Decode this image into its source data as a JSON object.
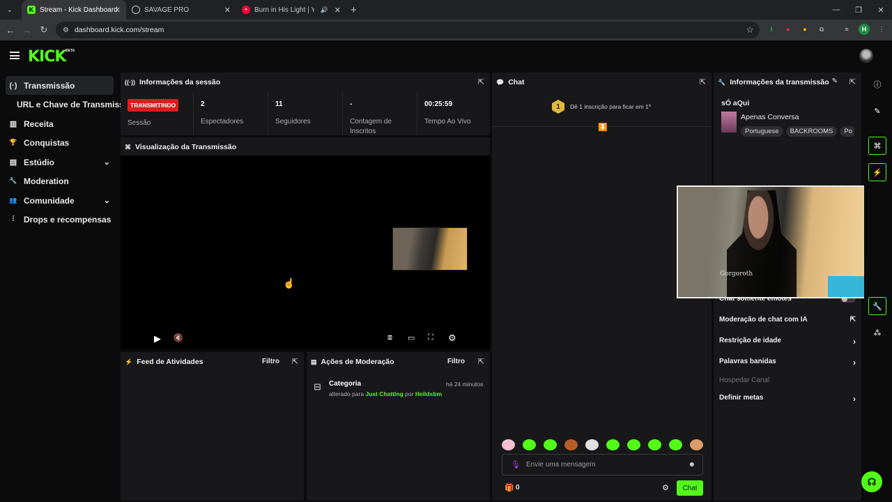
{
  "browser": {
    "tabs": [
      {
        "title": "Stream - Kick Dashboard",
        "favicon": "K"
      },
      {
        "title": "SAVAGE PRO",
        "favicon": ""
      },
      {
        "title": "Burn in His Light | YouTube",
        "favicon": "●"
      }
    ],
    "url": "dashboard.kick.com/stream",
    "profile_initial": "H"
  },
  "header": {
    "logo": "KICK",
    "beta": "BETA"
  },
  "sidebar": {
    "items": [
      {
        "label": "Transmissão",
        "icon": "(·)"
      },
      {
        "label": "URL e Chave de Transmissão",
        "icon": ""
      },
      {
        "label": "Receita",
        "icon": "▥"
      },
      {
        "label": "Conquistas",
        "icon": "🏆"
      },
      {
        "label": "Estúdio",
        "icon": "▤"
      },
      {
        "label": "Moderation",
        "icon": "🔧"
      },
      {
        "label": "Comunidade",
        "icon": "👥"
      },
      {
        "label": "Drops e recompensas",
        "icon": "⫶"
      }
    ]
  },
  "session": {
    "title": "Informações da sessão",
    "status": "TRANSMITINDO",
    "status_label": "Sessão",
    "viewers": "2",
    "viewers_label": "Espectadores",
    "followers": "11",
    "followers_label": "Seguidores",
    "subs": "-",
    "subs_label": "Contagem de Inscritos",
    "uptime": "00:25:59",
    "uptime_label": "Tempo Ao Vivo"
  },
  "preview": {
    "title": "Visualização da Transmissão"
  },
  "activity": {
    "title": "Feed de Atividades",
    "filter": "Filtro"
  },
  "moderation": {
    "title": "Ações de Moderação",
    "filter": "Filtro",
    "entry": {
      "title": "Categoria",
      "time": "há 24 minutos",
      "prefix": "alterado para",
      "category": "Just Chatting",
      "by": "por",
      "user": "Heildsbm"
    }
  },
  "chat": {
    "title": "Chat",
    "pinned_count": "1",
    "pinned_text": "Dê 1 inscrição para ficar em 1º",
    "placeholder": "Envie uma mensagem",
    "points": "0",
    "send_label": "Chat",
    "emote_colors": [
      "#f0c0d0",
      "#53fc18",
      "#53fc18",
      "#b85c2a",
      "#e0e0e0",
      "#53fc18",
      "#53fc18",
      "#53fc18",
      "#53fc18",
      "#d89c6a"
    ]
  },
  "info": {
    "title": "Informações da transmissão",
    "stream_title": "sÓ aQui",
    "category": "Apenas Conversa",
    "tags": [
      "Portuguese",
      "BACKROOMS",
      "Po"
    ],
    "emotes_only": "Chat somente emotes",
    "ai_mod": "Moderação de chat com IA",
    "age": "Restrição de idade",
    "banned": "Palavras banidas",
    "host": "Hospedar Canal",
    "goals": "Definir metas"
  },
  "webcam": {
    "shirt_text": "Gorgoroth"
  },
  "colors": {
    "accent": "#53fc18",
    "live": "#d91d1d",
    "panel": "#18181b"
  }
}
